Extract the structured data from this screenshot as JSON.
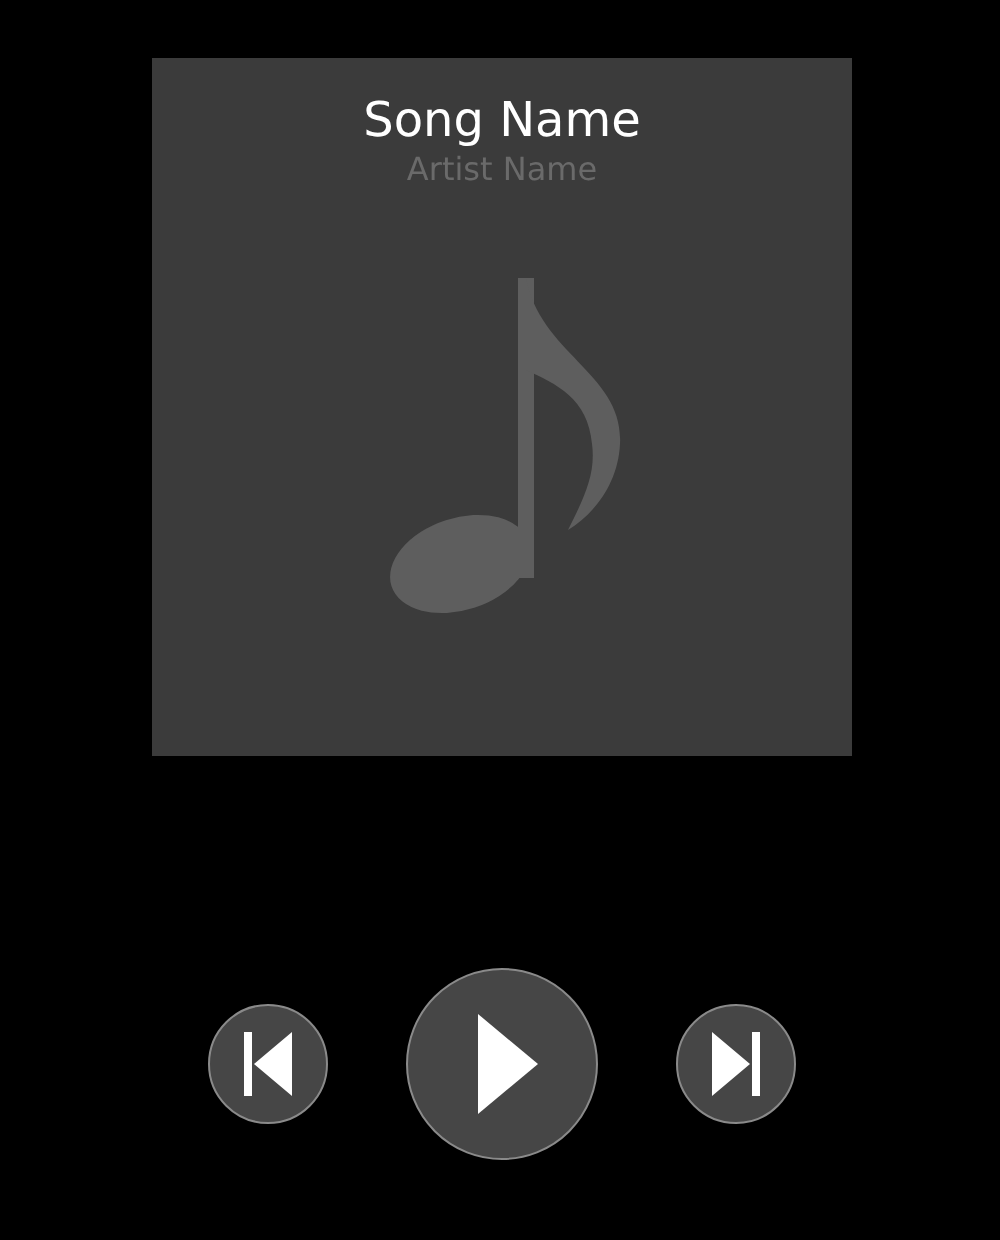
{
  "now_playing": {
    "title": "Song Name",
    "artist": "Artist Name"
  },
  "controls": [
    {
      "kind": "previous"
    },
    {
      "kind": "play"
    },
    {
      "kind": "next"
    }
  ]
}
